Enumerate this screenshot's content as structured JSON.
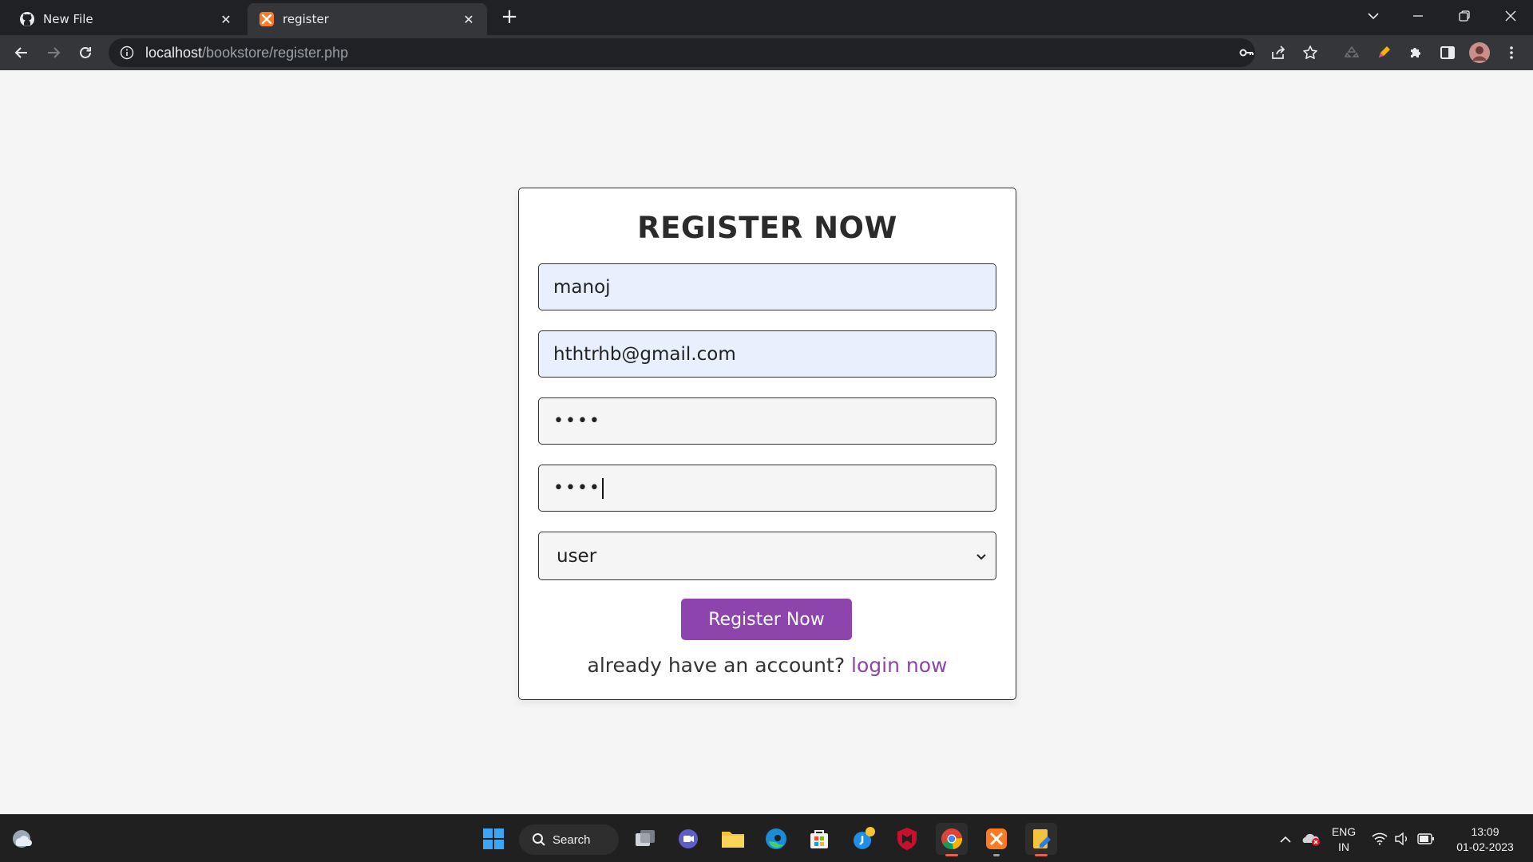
{
  "browser": {
    "tabs": [
      {
        "title": "New File",
        "favicon": "github-icon"
      },
      {
        "title": "register",
        "favicon": "xampp-icon",
        "active": true
      }
    ],
    "url_host": "localhost",
    "url_path": "/bookstore/register.php"
  },
  "form": {
    "title": "REGISTER NOW",
    "name_value": "manoj",
    "email_value": "hthtrhb@gmail.com",
    "password_value": "••••",
    "cpassword_value": "••••",
    "user_type_value": "user",
    "submit_label": "Register Now",
    "login_prompt": "already have an account?",
    "login_link": "login now"
  },
  "taskbar": {
    "search_label": "Search",
    "language_line1": "ENG",
    "language_line2": "IN",
    "time": "13:09",
    "date": "01-02-2023"
  },
  "colors": {
    "accent": "#8e44ad",
    "autofill": "#e8f0fe",
    "page_bg": "#f5f5f5"
  }
}
